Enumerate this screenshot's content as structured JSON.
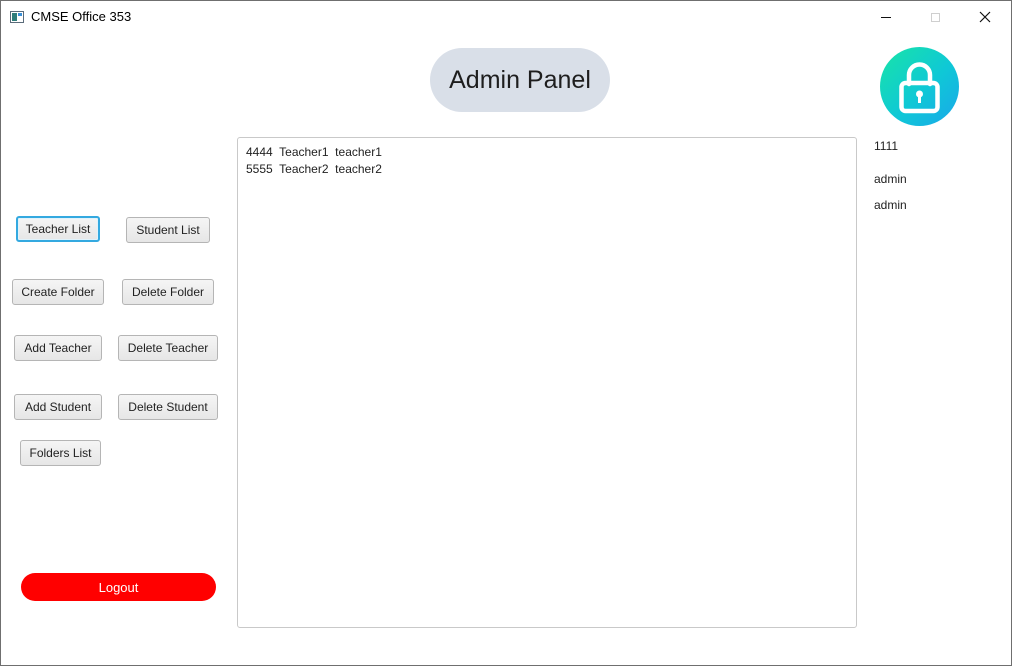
{
  "window": {
    "title": "CMSE Office 353",
    "controls": [
      "minimize",
      "maximize",
      "close"
    ]
  },
  "header": {
    "title": "Admin Panel",
    "badge_icon": "lock-icon"
  },
  "buttons": {
    "teacher_list": "Teacher List",
    "student_list": "Student List",
    "create_folder": "Create Folder",
    "delete_folder": "Delete Folder",
    "add_teacher": "Add Teacher",
    "delete_teacher": "Delete Teacher",
    "add_student": "Add Student",
    "delete_student": "Delete Student",
    "folders_list": "Folders List",
    "logout": "Logout"
  },
  "list": {
    "rows": [
      "4444  Teacher1  teacher1",
      "5555  Teacher2  teacher2"
    ]
  },
  "user_info": {
    "id": "1111",
    "name": "admin",
    "role": "admin"
  },
  "colors": {
    "logout": "#ff0000",
    "header_pill": "#d9dfe8",
    "focus": "#34a9e0",
    "lock_gradient_start": "#18e5a6",
    "lock_gradient_end": "#1aa7ea"
  }
}
